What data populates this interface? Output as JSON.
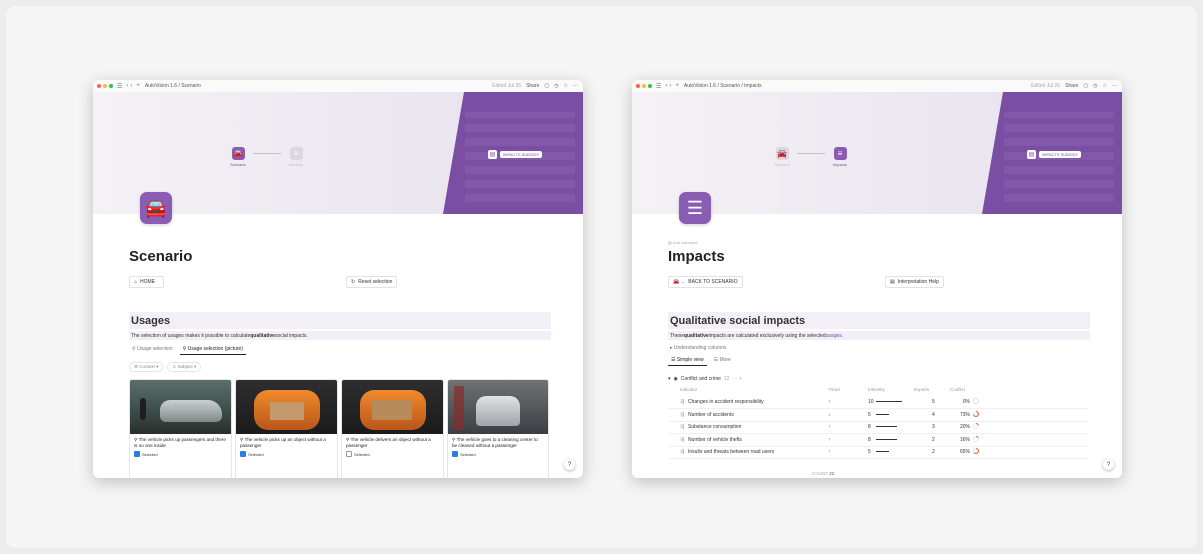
{
  "left_window": {
    "breadcrumb": "AutoVision 1.6 / Scenario",
    "edited": "Edited Jul 26",
    "share": "Share",
    "steps": [
      {
        "label": "Scenario",
        "state": "active"
      },
      {
        "label": "Impacts",
        "state": "inactive"
      }
    ],
    "impacts_subsidy": "IMPACTS SUBSIDY",
    "title": "Scenario",
    "home_button": "HOME",
    "reset_button": "Reset selection",
    "section_title": "Usages",
    "section_desc_pre": "The selection of usages makes it possible to calculate ",
    "section_desc_bold": "qualitative",
    "section_desc_post": " social impacts.",
    "tabs": [
      "Usage selection",
      "Usage selection (picture)"
    ],
    "filters": [
      "Context",
      "Subject"
    ],
    "cards": [
      {
        "caption": "The vehicle picks up passengers and there is no one inside",
        "selected_label": "Selected",
        "selected": true
      },
      {
        "caption": "The vehicle picks up an object without a passenger",
        "selected_label": "Selected",
        "selected": true
      },
      {
        "caption": "The vehicle delivers an object without a passenger",
        "selected_label": "Selected",
        "selected": false
      },
      {
        "caption": "The vehicle goes to a cleaning center to be cleaned without a passenger",
        "selected_label": "Selected",
        "selected": true
      }
    ],
    "help": "?"
  },
  "right_window": {
    "breadcrumb": "AutoVision 1.6 / Scenario / Impacts",
    "edited": "Edited Jul 26",
    "share": "Share",
    "steps": [
      {
        "label": "Scenario",
        "state": "inactive"
      },
      {
        "label": "Impacts",
        "state": "active"
      }
    ],
    "impacts_subsidy": "IMPACTS SUBSIDY",
    "add_comment": "Add comment",
    "title": "Impacts",
    "back_button": "BACK TO SCENARIO",
    "interp_button": "Interpretation Help",
    "section_title": "Qualitative social impacts",
    "section_desc_pre": "These ",
    "section_desc_bold": "qualitative",
    "section_desc_mid": " impacts are calculated exclusively using the selected ",
    "section_desc_link": "usages",
    "section_desc_post": ".",
    "understanding": "Understanding columns",
    "views": [
      "Simple view",
      "More"
    ],
    "group": {
      "name": "Conflict and crime",
      "count": "22"
    },
    "columns": [
      "Indicator",
      "Trend",
      "Intensity",
      "Experts",
      "Conflict"
    ],
    "rows": [
      {
        "indicator": "Changes in accident responsibility",
        "trend": "↑",
        "intensity": "10",
        "intensity_frac": 1.0,
        "experts": "5",
        "conflict": "0%",
        "conflict_frac": 0.0
      },
      {
        "indicator": "Number of accidents",
        "trend": "↓",
        "intensity": "5",
        "intensity_frac": 0.5,
        "experts": "4",
        "conflict": "73%",
        "conflict_frac": 0.73
      },
      {
        "indicator": "Substance consumption",
        "trend": "↑",
        "intensity": "8",
        "intensity_frac": 0.8,
        "experts": "3",
        "conflict": "20%",
        "conflict_frac": 0.2
      },
      {
        "indicator": "Number of vehicle thefts",
        "trend": "↑",
        "intensity": "8",
        "intensity_frac": 0.8,
        "experts": "2",
        "conflict": "16%",
        "conflict_frac": 0.16
      },
      {
        "indicator": "Insults and threats between road users",
        "trend": "↑",
        "intensity": "5",
        "intensity_frac": 0.5,
        "experts": "2",
        "conflict": "65%",
        "conflict_frac": 0.65
      }
    ],
    "count_label": "COUNT",
    "count_value": "22",
    "help": "?"
  },
  "colors": {
    "accent": "#7a4ea3",
    "accent_light": "#f3eff7",
    "checkbox": "#2d7be5",
    "conflict_ring": "#d9532c"
  }
}
